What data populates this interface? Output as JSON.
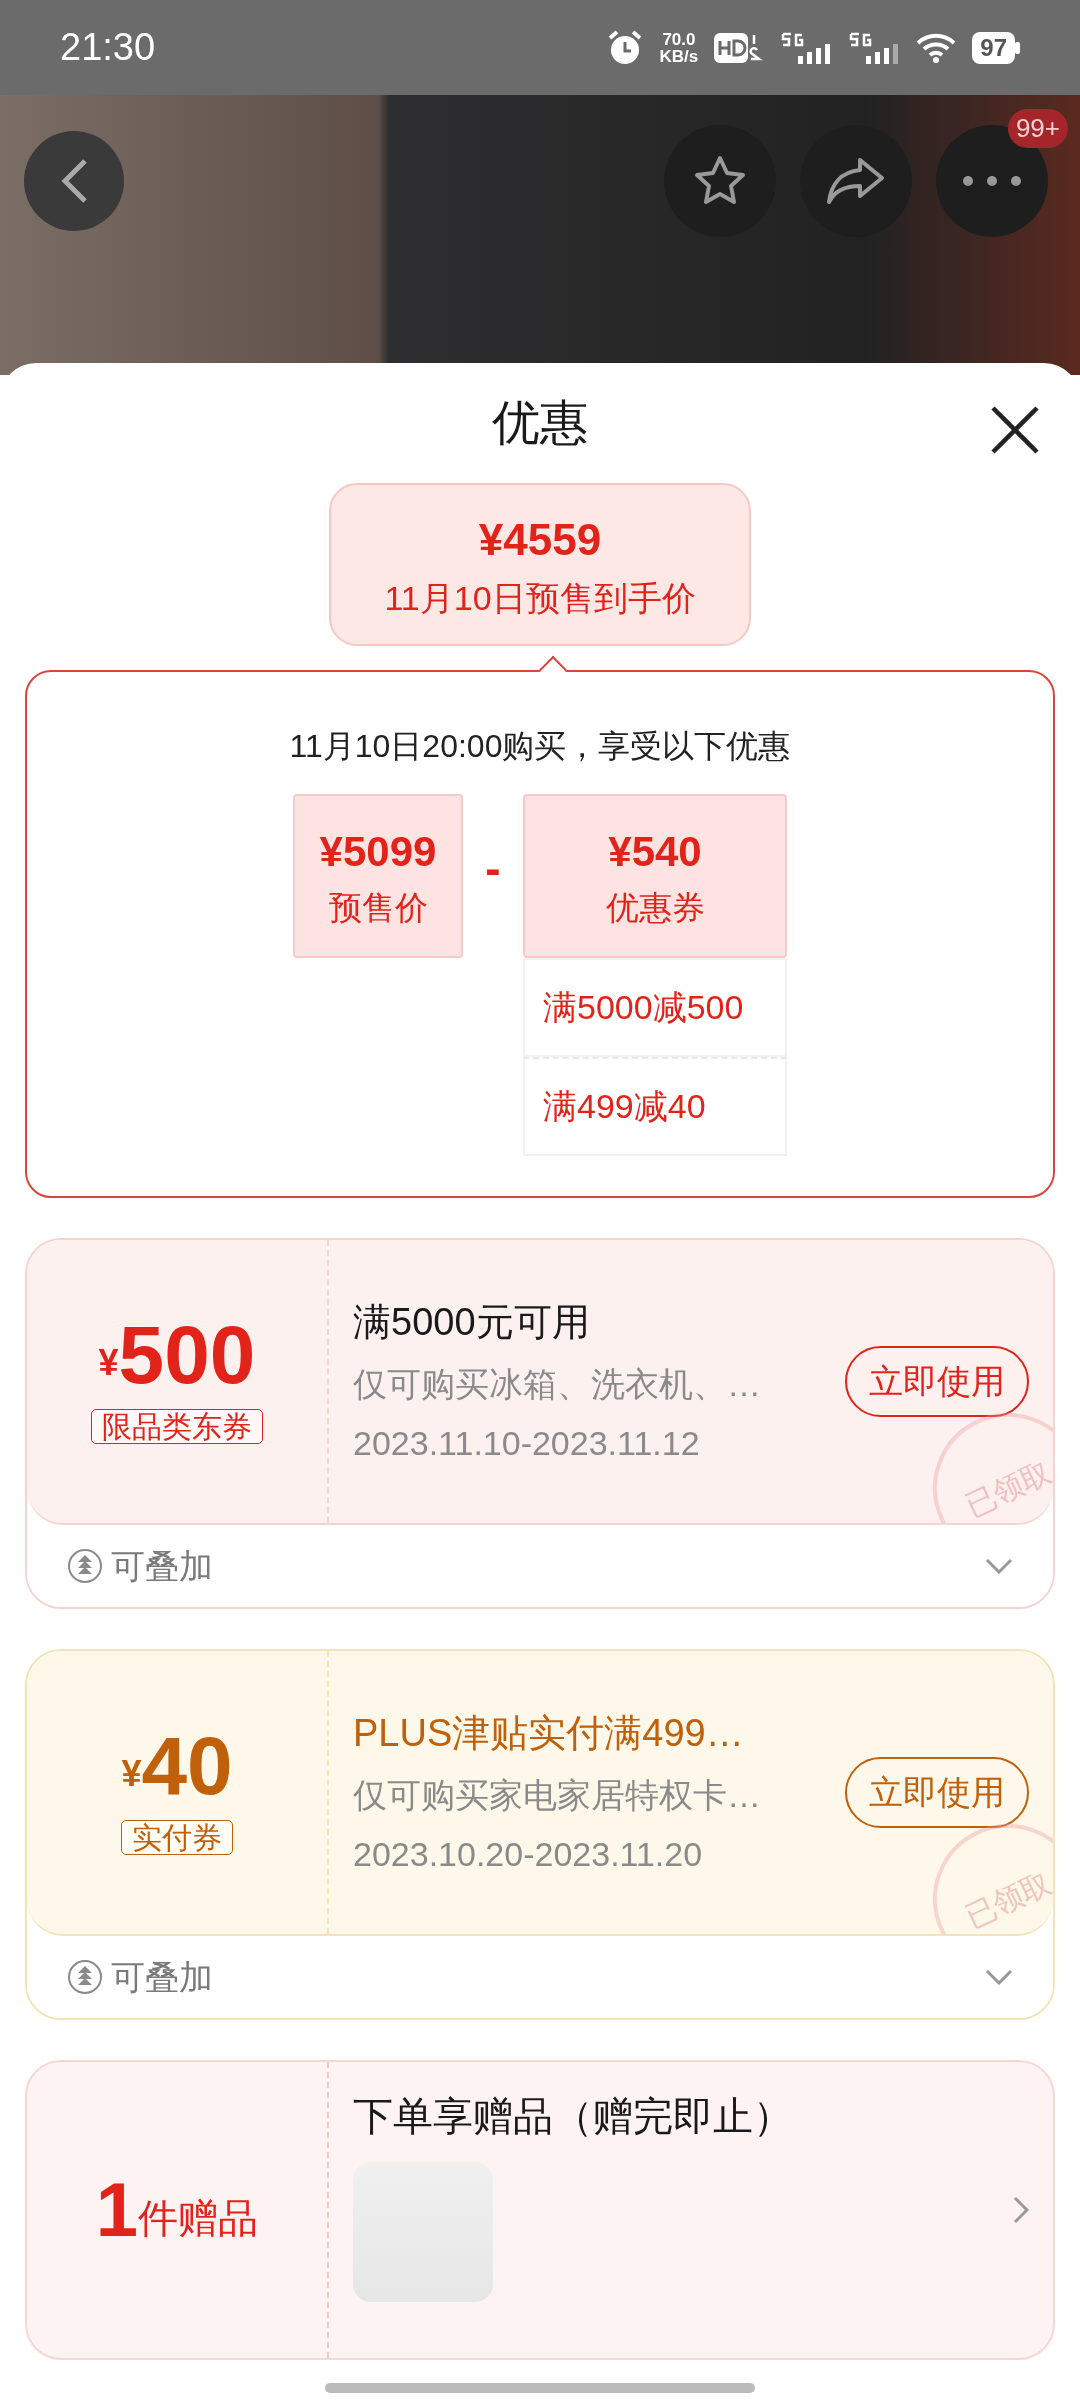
{
  "status_bar": {
    "time": "21:30",
    "net_speed": "70.0",
    "net_unit": "KB/s",
    "battery": "97"
  },
  "header": {
    "more_badge": "99+"
  },
  "sheet": {
    "title": "优惠"
  },
  "final_price": {
    "price": "¥4559",
    "label": "11月10日预售到手价"
  },
  "breakdown": {
    "heading": "11月10日20:00购买，享受以下优惠",
    "operator": "-",
    "terms": [
      {
        "amount": "¥5099",
        "label": "预售价"
      },
      {
        "amount": "¥540",
        "label": "优惠券",
        "details": [
          "满5000减500",
          "满499减40"
        ]
      }
    ]
  },
  "coupons": [
    {
      "kind": "category",
      "currency": "¥",
      "amount": "500",
      "tag": "限品类东券",
      "title": "满5000元可用",
      "description": "仅可购买冰箱、洗衣机、…",
      "validity": "2023.11.10-2023.11.12",
      "button": "立即使用",
      "stamp": "已领取",
      "stack_label": "可叠加",
      "expanded": false
    },
    {
      "kind": "plus",
      "currency": "¥",
      "amount": "40",
      "tag": "实付券",
      "title": "PLUS津贴实付满499…",
      "description": "仅可购买家电家居特权卡…",
      "validity": "2023.10.20-2023.11.20",
      "button": "立即使用",
      "stamp": "已领取",
      "stack_label": "可叠加",
      "expanded": false
    }
  ],
  "gift": {
    "count": "1",
    "unit": "件赠品",
    "title": "下单享赠品（赠完即止）"
  }
}
